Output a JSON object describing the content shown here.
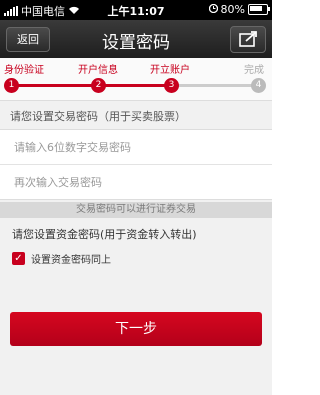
{
  "status_bar": {
    "carrier": "中国电信",
    "time": "上午11:07",
    "battery": "80%"
  },
  "nav": {
    "back_label": "返回",
    "title": "设置密码",
    "share_icon": "share-icon"
  },
  "steps": [
    {
      "label": "身份验证",
      "number": "1",
      "active": true
    },
    {
      "label": "开户信息",
      "number": "2",
      "active": true
    },
    {
      "label": "开立账户",
      "number": "3",
      "active": true
    },
    {
      "label": "完成",
      "number": "4",
      "active": false
    }
  ],
  "trade_password": {
    "section_label": "请您设置交易密码（用于买卖股票）",
    "input1_placeholder": "请输入6位数字交易密码",
    "input2_placeholder": "再次输入交易密码"
  },
  "hint": "交易密码可以进行证券交易",
  "fund_password": {
    "section_label": "请您设置资金密码(用于资金转入转出)",
    "checkbox_label": "设置资金密码同上",
    "checked": true
  },
  "next_button": "下一步",
  "colors": {
    "accent": "#c8001e"
  }
}
